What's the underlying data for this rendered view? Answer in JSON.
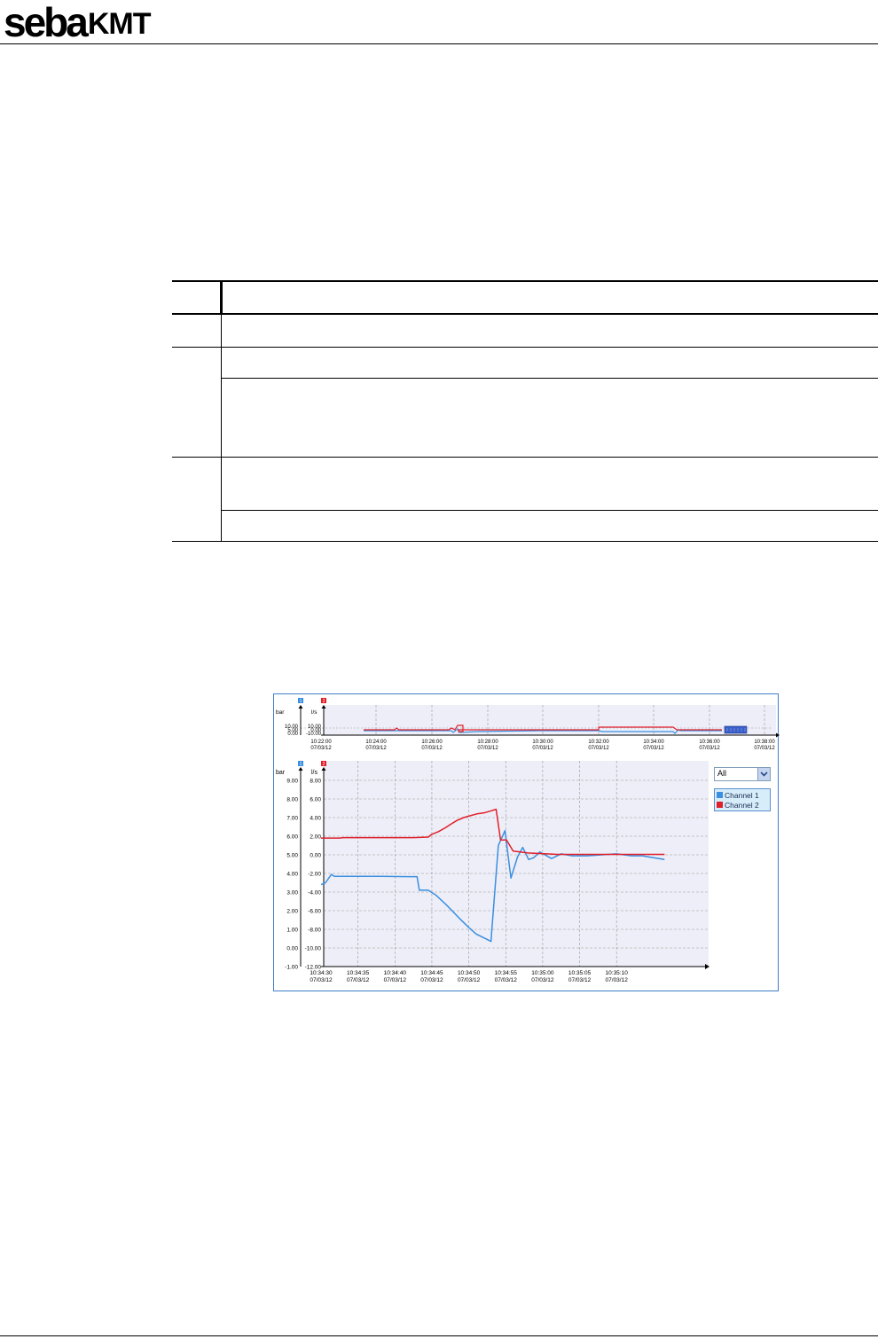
{
  "header": {
    "logo_main": "seba",
    "logo_suffix": "KMT"
  },
  "chart_controls": {
    "dropdown_value": "All",
    "legend": [
      {
        "label": "Channel 1",
        "color": "#3a8fe0"
      },
      {
        "label": "Channel 2",
        "color": "#e0202a"
      }
    ]
  },
  "chart_data": [
    {
      "type": "line",
      "role": "overview",
      "badges": [
        "1",
        "2"
      ],
      "unit_left": "bar",
      "unit_right": "l/s",
      "y_left_ticks": [
        "10.00",
        "5.00",
        "0.00"
      ],
      "y_right_ticks": [
        "10.00",
        "0.00",
        "-10.00"
      ],
      "x_ticks": [
        [
          "10:22:00",
          "07/03/12"
        ],
        [
          "10:24:00",
          "07/03/12"
        ],
        [
          "10:26:00",
          "07/03/12"
        ],
        [
          "10:28:00",
          "07/03/12"
        ],
        [
          "10:30:00",
          "07/03/12"
        ],
        [
          "10:32:00",
          "07/03/12"
        ],
        [
          "10:34:00",
          "07/03/12"
        ],
        [
          "10:36:00",
          "07/03/12"
        ],
        [
          "10:38:00",
          "07/03/12"
        ]
      ],
      "series": [
        {
          "name": "Channel 1",
          "color": "#3a8fe0"
        },
        {
          "name": "Channel 2",
          "color": "#e0202a"
        }
      ],
      "selection_range": [
        "10:36:30",
        "10:37:15"
      ]
    },
    {
      "type": "line",
      "role": "detail",
      "badges": [
        "1",
        "2"
      ],
      "unit_left": "bar",
      "unit_right": "l/s",
      "y_left_range": [
        -1,
        9
      ],
      "y_left_ticks": [
        "9.00",
        "8.00",
        "7.00",
        "6.00",
        "5.00",
        "4.00",
        "3.00",
        "2.00",
        "1.00",
        "0.00",
        "-1.00"
      ],
      "y_right_range": [
        -12,
        8
      ],
      "y_right_ticks": [
        "8.00",
        "6.00",
        "4.00",
        "2.00",
        "0.00",
        "-2.00",
        "-4.00",
        "-6.00",
        "-8.00",
        "-10.00",
        "-12.00"
      ],
      "x_ticks": [
        [
          "10:34:30",
          "07/03/12"
        ],
        [
          "10:34:35",
          "07/03/12"
        ],
        [
          "10:34:40",
          "07/03/12"
        ],
        [
          "10:34:45",
          "07/03/12"
        ],
        [
          "10:34:50",
          "07/03/12"
        ],
        [
          "10:34:55",
          "07/03/12"
        ],
        [
          "10:35:00",
          "07/03/12"
        ],
        [
          "10:35:05",
          "07/03/12"
        ],
        [
          "10:35:10",
          "07/03/12"
        ]
      ],
      "x_range_seconds": [
        0,
        46.5
      ],
      "grid": true,
      "series": [
        {
          "name": "Channel 1",
          "color": "#3a8fe0",
          "axis": "left",
          "x": [
            0,
            0.6,
            1.4,
            1.8,
            4,
            8,
            12,
            13,
            13.3,
            14.5,
            15.5,
            17,
            18.7,
            20,
            21,
            22,
            23,
            24,
            24.9,
            25.7,
            26.6,
            27.3,
            28.1,
            28.8,
            29.6,
            30.3,
            31.2,
            32.5,
            34,
            36,
            38,
            40,
            42,
            43.5,
            45,
            46.5
          ],
          "y": [
            3.4,
            3.5,
            3.95,
            3.85,
            3.85,
            3.85,
            3.83,
            3.83,
            3.1,
            3.1,
            2.85,
            2.3,
            1.6,
            1.1,
            0.75,
            0.55,
            0.35,
            5.5,
            6.3,
            3.75,
            4.9,
            5.4,
            4.75,
            4.85,
            5.15,
            5.0,
            4.8,
            5.05,
            4.95,
            4.95,
            5.0,
            5.05,
            4.95,
            4.95,
            4.85,
            4.75
          ]
        },
        {
          "name": "Channel 2",
          "color": "#e0202a",
          "axis": "right",
          "x": [
            0,
            2.5,
            3.0,
            5,
            10,
            12.5,
            14.5,
            15,
            15.9,
            16.8,
            17.6,
            18.4,
            19.3,
            20.2,
            21.1,
            22,
            22.9,
            23.7,
            24.3,
            25.1,
            26,
            28,
            32,
            40,
            46.5
          ],
          "y": [
            1.8,
            1.8,
            1.85,
            1.85,
            1.85,
            1.85,
            1.9,
            2.2,
            2.5,
            2.9,
            3.3,
            3.7,
            4.0,
            4.2,
            4.4,
            4.5,
            4.7,
            4.9,
            1.6,
            1.6,
            0.4,
            0.2,
            0.05,
            0.05,
            0.05
          ]
        }
      ]
    }
  ]
}
